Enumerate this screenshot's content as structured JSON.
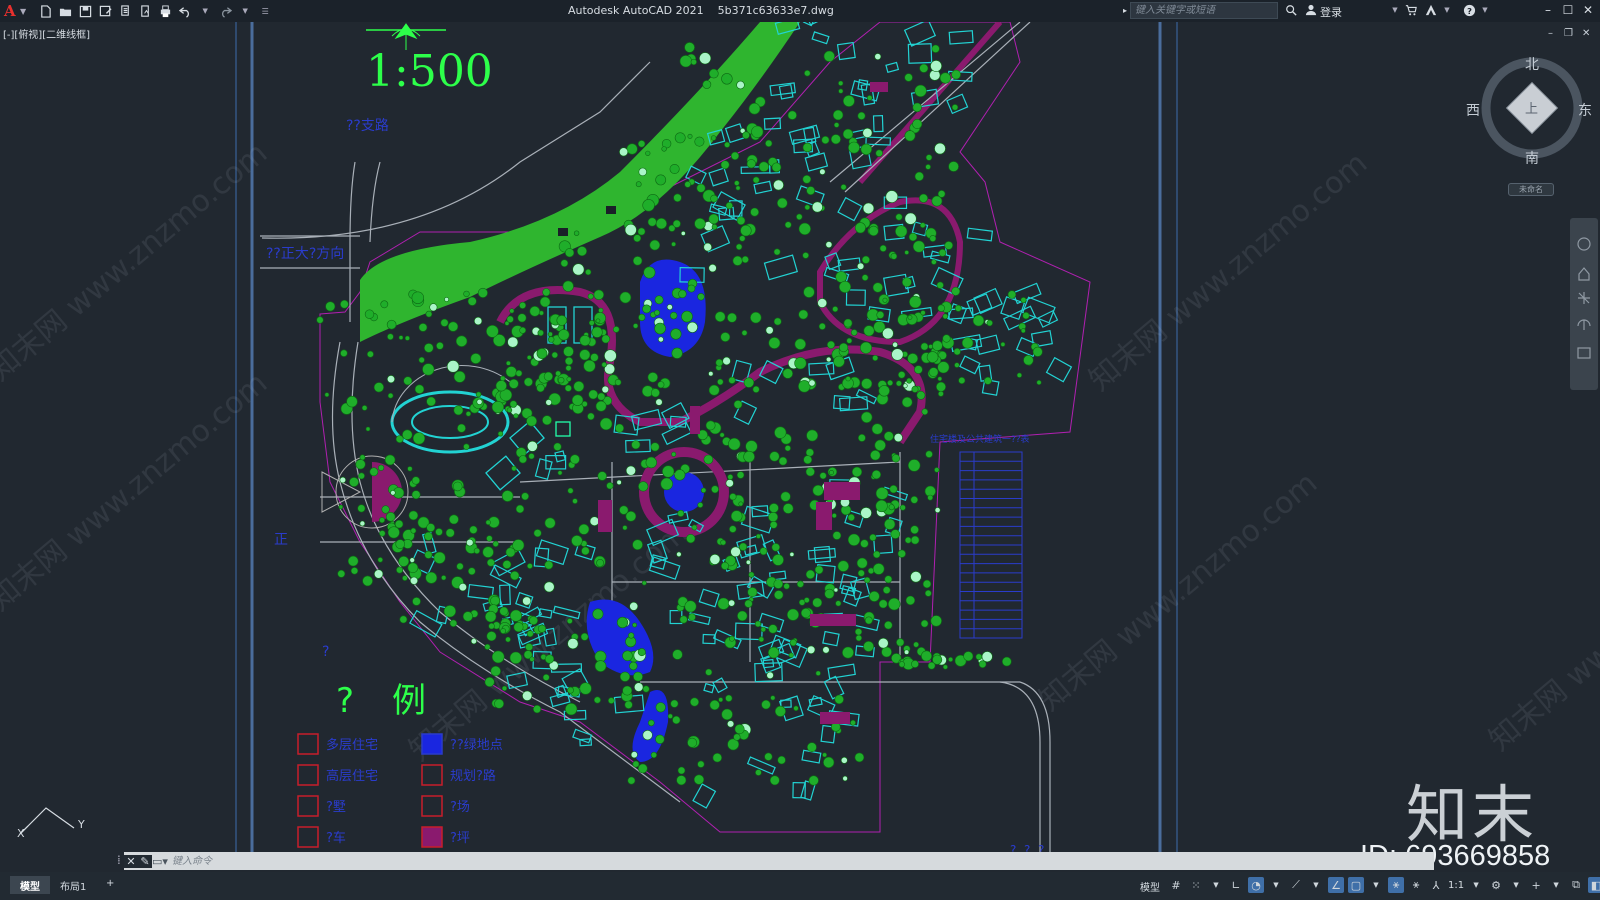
{
  "titlebar": {
    "app_title": "Autodesk AutoCAD 2021",
    "file_name": "5b371c63633e7.dwg",
    "search_placeholder": "键入关键字或短语",
    "login_label": "登录"
  },
  "viewport": {
    "label": "[-][俯视][二维线框]"
  },
  "drawing": {
    "scale_text": "1:500",
    "label_top_road": "??支路",
    "label_left_road": "??正大?方向",
    "label_table_title": "住宅楼及公共建筑一??表",
    "label_legend_title_a": "?",
    "label_legend_title_b": "例",
    "label_east_mark": "正",
    "label_left_q": "?",
    "label_bottom": "?. ?. ?",
    "legend_items": [
      {
        "label": "多层住宅",
        "type": "box-red"
      },
      {
        "label": "??绿地点",
        "type": "box-blue"
      },
      {
        "label": "高层住宅",
        "type": "box-red"
      },
      {
        "label": "规划?路",
        "type": "box-red"
      },
      {
        "label": "?墅",
        "type": "box-red"
      },
      {
        "label": "?场",
        "type": "box-red"
      },
      {
        "label": "?车",
        "type": "box-red"
      },
      {
        "label": "?坪",
        "type": "box-magenta"
      }
    ],
    "colors": {
      "background": "#212830",
      "grass": "#2fb52f",
      "building_outline": "#22d3d3",
      "road_magenta": "#8a1a6e",
      "water_blue": "#1a26e0",
      "green_text": "#2dff4a",
      "blue_text": "#2a3ccc",
      "frame_blue": "#4a6d9c"
    }
  },
  "navcube": {
    "north": "北",
    "south": "南",
    "east": "东",
    "west": "西",
    "top_face": "上",
    "wcs_label": "未命名"
  },
  "watermarks": {
    "text": "知末网 www.znzmo.com",
    "brand": "知末",
    "id_text": "ID: 693669858"
  },
  "commandline": {
    "placeholder": "键入命令"
  },
  "statusbar": {
    "tabs": [
      "模型",
      "布局1"
    ],
    "add_tab": "+",
    "model_label": "模型",
    "scale_label": "1:1"
  },
  "ucs": {
    "x_label": "X",
    "y_label": "Y"
  }
}
